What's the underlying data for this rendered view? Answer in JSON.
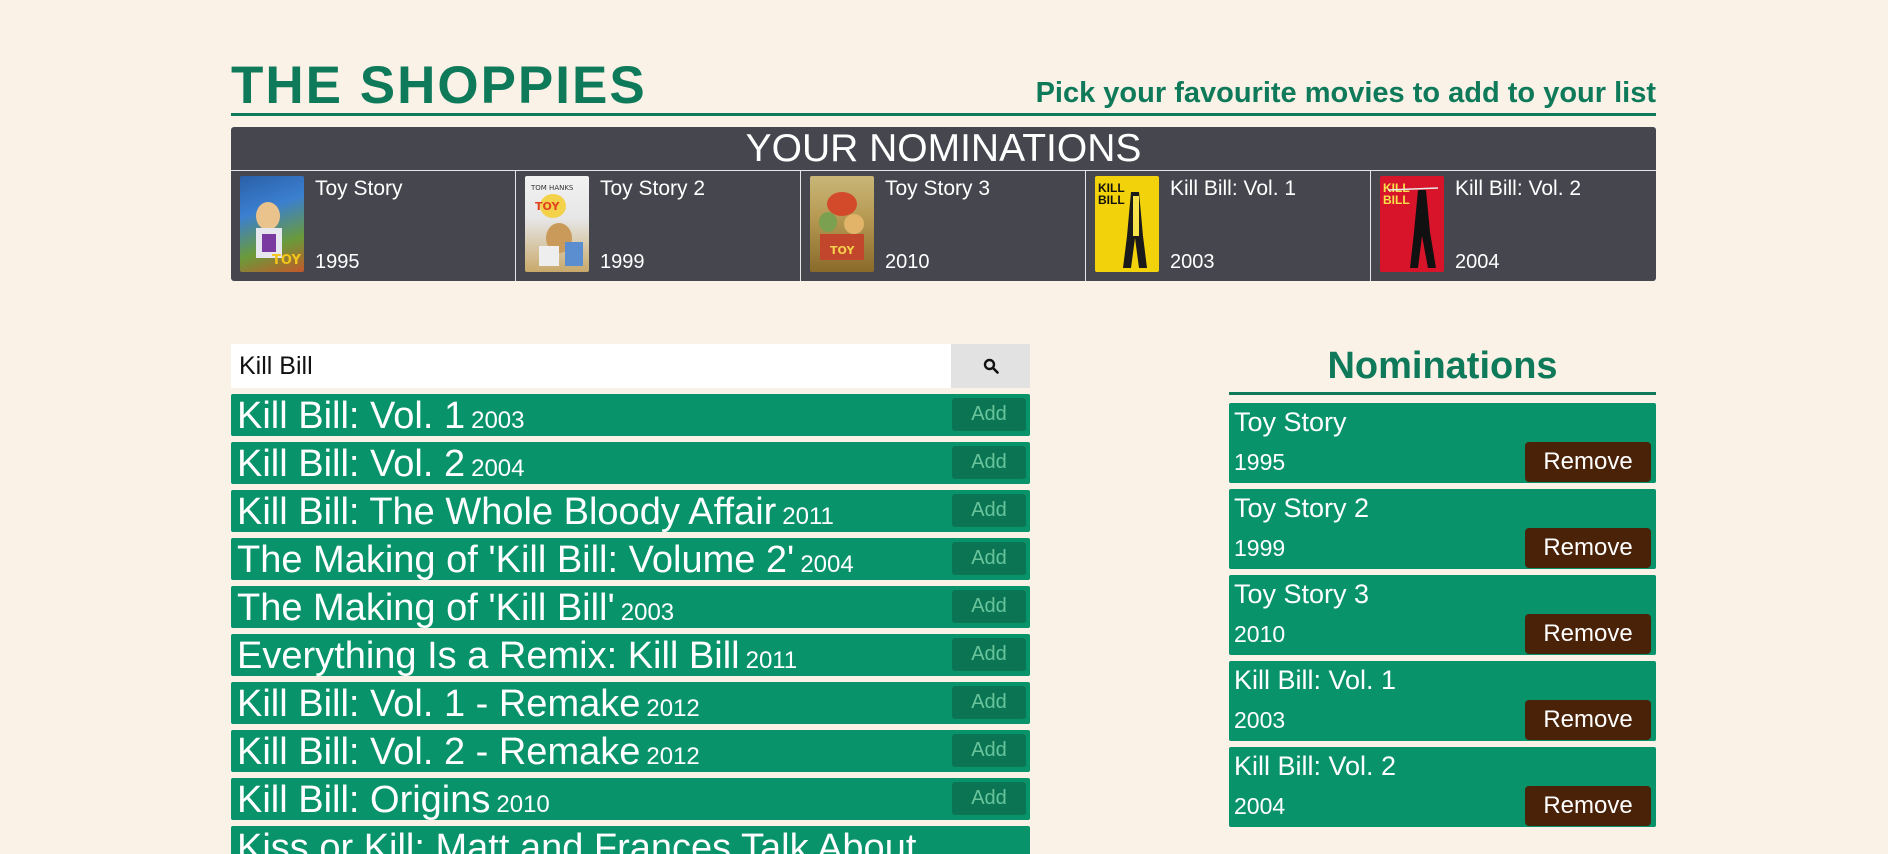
{
  "header": {
    "brand": "THE SHOPPIES",
    "tagline": "Pick your favourite movies to add to your list"
  },
  "banner": {
    "title": "YOUR NOMINATIONS",
    "cards": [
      {
        "title": "Toy Story",
        "year": "1995",
        "poster": "toy-story-poster"
      },
      {
        "title": "Toy Story 2",
        "year": "1999",
        "poster": "toy-story-2-poster"
      },
      {
        "title": "Toy Story 3",
        "year": "2010",
        "poster": "toy-story-3-poster"
      },
      {
        "title": "Kill Bill: Vol. 1",
        "year": "2003",
        "poster": "kill-bill-vol-1-poster"
      },
      {
        "title": "Kill Bill: Vol. 2",
        "year": "2004",
        "poster": "kill-bill-vol-2-poster"
      }
    ]
  },
  "search": {
    "value": "Kill Bill",
    "button_icon": "search-icon"
  },
  "results": [
    {
      "title": "Kill Bill: Vol. 1",
      "year": "2003",
      "add_label": "Add"
    },
    {
      "title": "Kill Bill: Vol. 2",
      "year": "2004",
      "add_label": "Add"
    },
    {
      "title": "Kill Bill: The Whole Bloody Affair",
      "year": "2011",
      "add_label": "Add"
    },
    {
      "title": "The Making of 'Kill Bill: Volume 2'",
      "year": "2004",
      "add_label": "Add"
    },
    {
      "title": "The Making of 'Kill Bill'",
      "year": "2003",
      "add_label": "Add"
    },
    {
      "title": "Everything Is a Remix: Kill Bill",
      "year": "2011",
      "add_label": "Add"
    },
    {
      "title": "Kill Bill: Vol. 1 - Remake",
      "year": "2012",
      "add_label": "Add"
    },
    {
      "title": "Kill Bill: Vol. 2 - Remake",
      "year": "2012",
      "add_label": "Add"
    },
    {
      "title": "Kill Bill: Origins",
      "year": "2010",
      "add_label": "Add"
    },
    {
      "title": "Kiss or Kill: Matt and Frances Talk About",
      "year": "",
      "add_label": ""
    }
  ],
  "nominations": {
    "title": "Nominations",
    "items": [
      {
        "title": "Toy Story",
        "year": "1995",
        "remove_label": "Remove"
      },
      {
        "title": "Toy Story 2",
        "year": "1999",
        "remove_label": "Remove"
      },
      {
        "title": "Toy Story 3",
        "year": "2010",
        "remove_label": "Remove"
      },
      {
        "title": "Kill Bill: Vol. 1",
        "year": "2003",
        "remove_label": "Remove"
      },
      {
        "title": "Kill Bill: Vol. 2",
        "year": "2004",
        "remove_label": "Remove"
      }
    ]
  },
  "colors": {
    "background": "#faf1e7",
    "accent": "#0e7a5a",
    "row_green": "#08936b",
    "banner_dark": "#45464e",
    "remove_brown": "#4a2208"
  }
}
